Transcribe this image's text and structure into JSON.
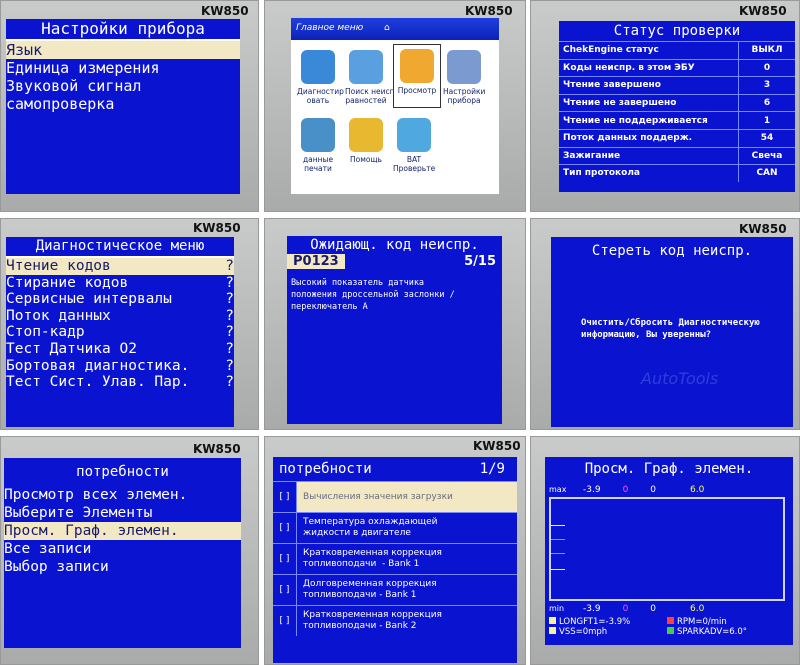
{
  "brand": "KW850",
  "panels": {
    "settings": {
      "title": "Настройки прибора",
      "items": [
        "Язык",
        "Единица измерения",
        "Звуковой сигнал",
        "самопроверка"
      ],
      "selected": 0
    },
    "main_menu": {
      "title": "Главное меню",
      "icons": [
        {
          "name": "diagnostics",
          "label": "Диагностир\nовать",
          "color": "#3a88d8"
        },
        {
          "name": "search",
          "label": "Поиск неисп\nравностей",
          "color": "#5aa0e0"
        },
        {
          "name": "view",
          "label": "Просмотр",
          "color": "#f0a830"
        },
        {
          "name": "settings",
          "label": "Настройки\nприбора",
          "color": "#7a9ad0"
        },
        {
          "name": "print",
          "label": "данные\nпечати",
          "color": "#4a90c8"
        },
        {
          "name": "help",
          "label": "Помощь",
          "color": "#e8b830"
        },
        {
          "name": "battery",
          "label": "BAT\nПроверьте",
          "color": "#50a8e0"
        }
      ]
    },
    "status": {
      "title": "Статус проверки",
      "rows": [
        {
          "k": "ChekEngine статус",
          "v": "ВЫКЛ"
        },
        {
          "k": "Коды неиспр. в этом ЭБУ",
          "v": "0"
        },
        {
          "k": "Чтение завершено",
          "v": "3"
        },
        {
          "k": "Чтение не завершено",
          "v": "6"
        },
        {
          "k": "Чтение не поддерживается",
          "v": "1"
        },
        {
          "k": "Поток данных поддерж.",
          "v": "54"
        },
        {
          "k": "Зажигание",
          "v": "Свеча"
        },
        {
          "k": "Тип протокола",
          "v": "CAN"
        }
      ]
    },
    "diag": {
      "title": "Диагностическое меню",
      "items": [
        "Чтение кодов",
        "Стирание кодов",
        "Сервисные интервалы",
        "Поток данных",
        "Стоп-кадр",
        "Тест Датчика O2",
        "Бортовая диагностика.",
        "Тест Сист. Улав. Пар."
      ],
      "mark": "?",
      "selected": 0
    },
    "dtc": {
      "title": "Ожидающ. код неиспр.",
      "code": "P0123",
      "page": "5/15",
      "text": "Высокий показатель датчика\nположения дроссельной заслонки /\nпереключатель A"
    },
    "erase": {
      "title": "Стереть код неиспр.",
      "text": "Очистить/Сбросить Диагностическую\nинформацию, Вы уверенны?"
    },
    "needs": {
      "title": "потребности",
      "items": [
        "Просмотр всех элемен.",
        "Выберите Элементы",
        "Просм. Граф. элемен.",
        "Все записи",
        "Выбор записи"
      ],
      "selected": 2
    },
    "select": {
      "title": "потребности",
      "page": "1/9",
      "cb": "[ ]",
      "items": [
        "Вычисления значения загрузки",
        "Температура охлаждающей\nжидкости в двигателе",
        "Кратковременная коррекция\nтопливоподачи  - Bank 1",
        "Долговременная коррекция\nтопливоподачи - Bank 1",
        "Кратковременная коррекция\nтопливоподачи - Bank 2"
      ]
    },
    "graph": {
      "title": "Просм. Граф. элемен.",
      "max_label": "max",
      "min_label": "min",
      "vals": [
        {
          "t": "-3.9",
          "c": "#ffffff"
        },
        {
          "t": "0",
          "c": "#ff4fff"
        },
        {
          "t": "0",
          "c": "#ffffff"
        },
        {
          "t": "6.0",
          "c": "#ffff66"
        }
      ],
      "legend": [
        {
          "t": "LONGFT1=-3.9%",
          "c": "#f2f2a0"
        },
        {
          "t": "RPM=0/min",
          "c": "#ff4040"
        },
        {
          "t": "VSS=0mph",
          "c": "#f2f2a0"
        },
        {
          "t": "SPARKADV=6.0°",
          "c": "#40d040"
        }
      ]
    }
  },
  "watermark": "AutoTools"
}
